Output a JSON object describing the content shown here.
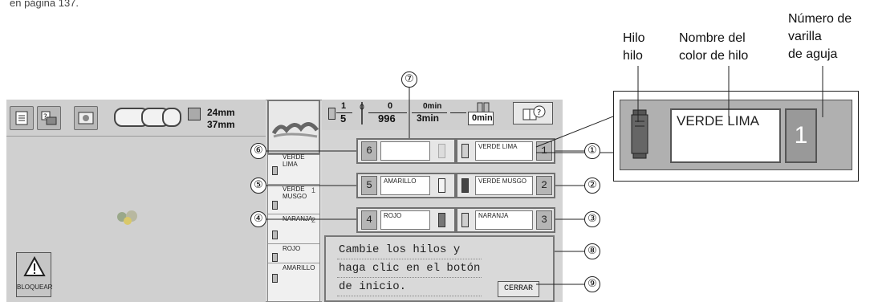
{
  "top_text": "en página 137.",
  "toolbar": {
    "width_value": "24mm",
    "height_value": "37mm"
  },
  "lock_button_label": "BLOQUEAR",
  "sequence_list": [
    {
      "label": "VERDE LIMA",
      "number": "1"
    },
    {
      "label": "VERDE MUSGO",
      "number": "2"
    },
    {
      "label": "NARANJA",
      "number": "3"
    },
    {
      "label": "ROJO",
      "number": ""
    },
    {
      "label": "AMARILLO",
      "number": ""
    }
  ],
  "stitch_info": {
    "color_current": "1",
    "color_total": "5",
    "stitch_current": "0",
    "stitch_total": "996",
    "time_current": "0min",
    "time_total": "3min",
    "time_remaining": "0min"
  },
  "needles_left": [
    {
      "number": "6",
      "name": ""
    },
    {
      "number": "5",
      "name": "AMARILLO"
    },
    {
      "number": "4",
      "name": "ROJO"
    }
  ],
  "needles_right": [
    {
      "number": "1",
      "name": "VERDE LIMA"
    },
    {
      "number": "2",
      "name": "VERDE MUSGO"
    },
    {
      "number": "3",
      "name": "NARANJA"
    }
  ],
  "message": {
    "line1": "Cambie los hilos y",
    "line2": "haga clic en el botón",
    "line3": "de inicio.",
    "close_label": "CERRAR"
  },
  "callouts": [
    "①",
    "②",
    "③",
    "④",
    "⑤",
    "⑥",
    "⑦",
    "⑧",
    "⑨"
  ],
  "zoom": {
    "label_thread": "Hilo",
    "label_thread2": "hilo",
    "label_color_name1": "Nombre del",
    "label_color_name2": "color de hilo",
    "label_needle1": "Número de",
    "label_needle2": "varilla",
    "label_needle3": "de aguja",
    "thread_name": "VERDE LIMA",
    "needle_number": "1"
  }
}
